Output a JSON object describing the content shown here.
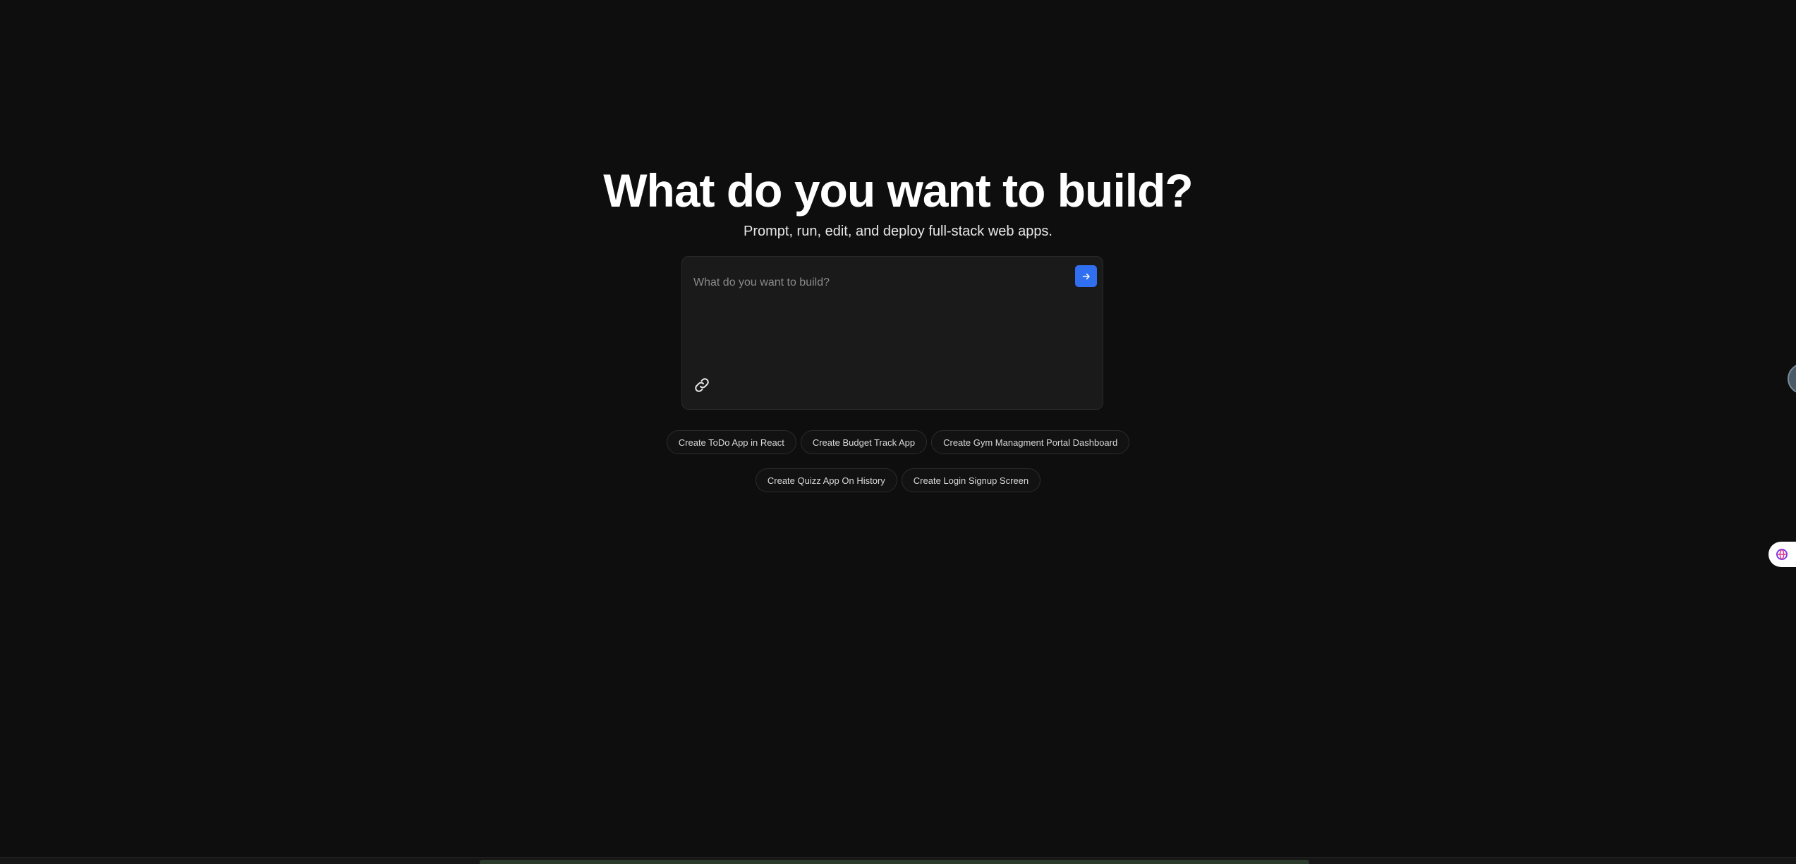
{
  "hero": {
    "title": "What do you want to build?",
    "subtitle": "Prompt, run, edit, and deploy full-stack web apps."
  },
  "prompt": {
    "placeholder": "What do you want to build?",
    "value": "",
    "submit_icon": "arrow-right-icon",
    "attach_icon": "link-icon"
  },
  "suggestions": {
    "row1": [
      "Create ToDo App in React",
      "Create Budget Track App",
      "Create Gym Managment Portal Dashboard"
    ],
    "row2": [
      "Create Quizz App On History",
      "Create Login Signup Screen"
    ]
  },
  "colors": {
    "background": "#0e0e0e",
    "accent": "#2f6ff0",
    "chip_border": "#2c2c2c"
  }
}
